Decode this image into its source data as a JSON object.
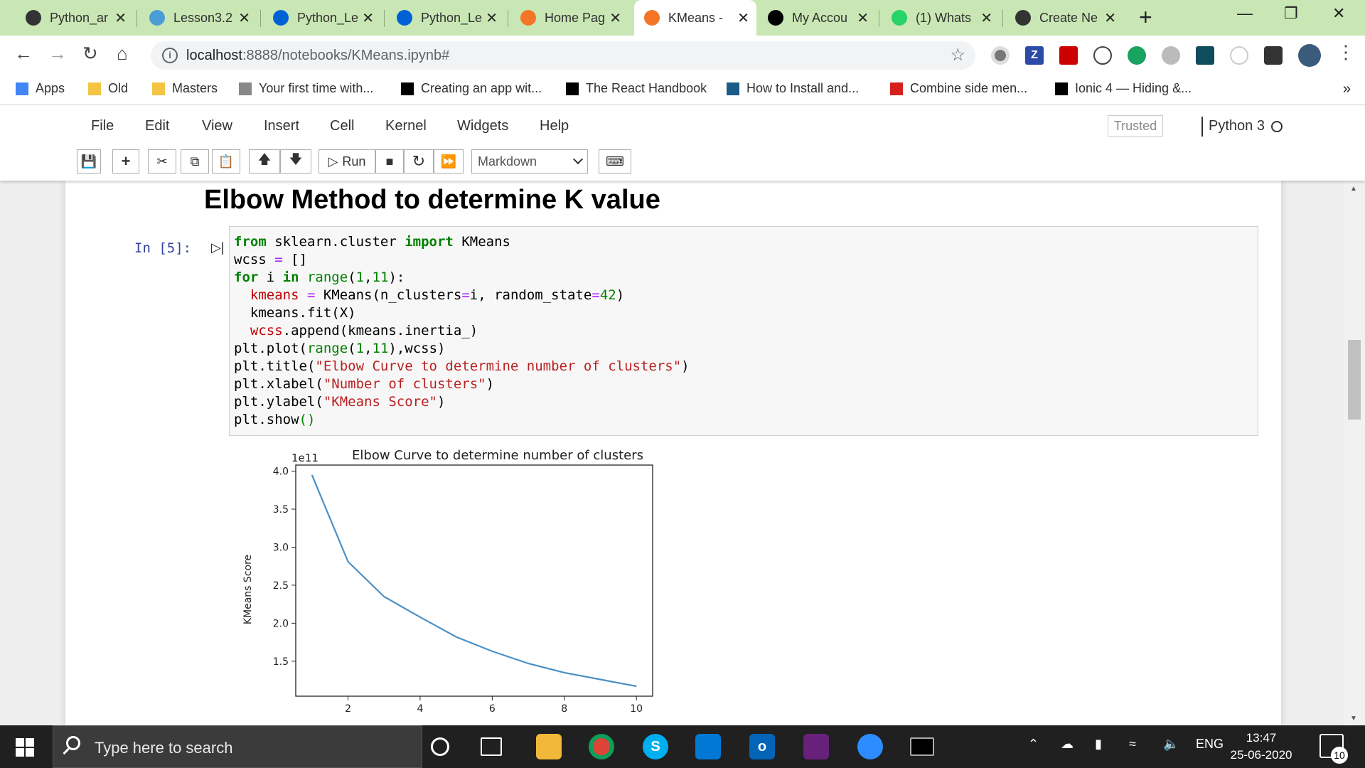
{
  "browser": {
    "tabs": [
      {
        "title": "Python_ar",
        "icon": "github-icon",
        "color": "#333333"
      },
      {
        "title": "Lesson3.2",
        "icon": "unc-icon",
        "color": "#4b9cd3"
      },
      {
        "title": "Python_Le",
        "icon": "box-icon",
        "color": "#0061d5"
      },
      {
        "title": "Python_Le",
        "icon": "box-icon",
        "color": "#0061d5"
      },
      {
        "title": "Home Pag",
        "icon": "spinner-icon",
        "color": "#f37626"
      },
      {
        "title": "KMeans -",
        "icon": "jupyter-icon",
        "color": "#f37626",
        "active": true
      },
      {
        "title": "My Accou",
        "icon": "kc-icon",
        "color": "#000000"
      },
      {
        "title": "(1) Whats",
        "icon": "whatsapp-icon",
        "color": "#25d366"
      },
      {
        "title": "Create Ne",
        "icon": "github-icon",
        "color": "#333333"
      }
    ],
    "url_host": "localhost",
    "url_path": ":8888/notebooks/KMeans.ipynb#",
    "bookmarks": [
      {
        "label": "Apps",
        "icon": "apps-grid-icon"
      },
      {
        "label": "Old",
        "icon": "folder-icon"
      },
      {
        "label": "Masters",
        "icon": "folder-icon"
      },
      {
        "label": "Your first time with...",
        "icon": "person-icon"
      },
      {
        "label": "Creating an app wit...",
        "icon": "dev-icon"
      },
      {
        "label": "The React Handbook",
        "icon": "react-handbook-icon"
      },
      {
        "label": "How to Install and...",
        "icon": "react-icon"
      },
      {
        "label": "Combine side men...",
        "icon": "ionic-icon"
      },
      {
        "label": "Ionic 4 — Hiding &...",
        "icon": "medium-icon"
      }
    ],
    "bookmarks_overflow": "»"
  },
  "jupyter": {
    "menu": [
      "File",
      "Edit",
      "View",
      "Insert",
      "Cell",
      "Kernel",
      "Widgets",
      "Help"
    ],
    "trusted": "Trusted",
    "kernel": "Python 3",
    "run_label": "Run",
    "cell_type": "Markdown",
    "heading": "Elbow Method to determine K value",
    "prompt": "In [5]:"
  },
  "code": {
    "l1_kw1": "from",
    "l1_mod": " sklearn.cluster ",
    "l1_kw2": "import",
    "l1_name": " KMeans",
    "l2": "wcss ",
    "l2_op": "=",
    "l2_rest": " []",
    "l3_kw": "for",
    "l3_i": " i ",
    "l3_in": "in",
    "l3_range": " range",
    "l3_args": "(",
    "l3_n1": "1",
    "l3_c": ",",
    "l3_n2": "11",
    "l3_end": "):",
    "l4_var": "  kmeans ",
    "l4_op": "=",
    "l4_call": " KMeans(n_clusters",
    "l4_op2": "=",
    "l4_mid": "i, random_state",
    "l4_op3": "=",
    "l4_num": "42",
    "l4_end": ")",
    "l5": "  kmeans.fit(X)",
    "l6_var": "  wcss",
    "l6_rest": ".append(kmeans.inertia_)",
    "l7_a": "plt.plot(",
    "l7_range": "range",
    "l7_b": "(",
    "l7_n1": "1",
    "l7_c": ",",
    "l7_n2": "11",
    "l7_d": "),wcss)",
    "l8_a": "plt.title(",
    "l8_s": "\"Elbow Curve to determine number of clusters\"",
    "l8_b": ")",
    "l9_a": "plt.xlabel(",
    "l9_s": "\"Number of clusters\"",
    "l9_b": ")",
    "l10_a": "plt.ylabel(",
    "l10_s": "\"KMeans Score\"",
    "l10_b": ")",
    "l11_a": "plt.show",
    "l11_b": "()"
  },
  "chart_data": {
    "type": "line",
    "title": "Elbow Curve to determine number of clusters",
    "xlabel": "",
    "ylabel": "KMeans Score",
    "offset_text": "1e11",
    "x": [
      1,
      2,
      3,
      4,
      5,
      6,
      7,
      8,
      9,
      10
    ],
    "y": [
      3.95,
      2.81,
      2.35,
      2.08,
      1.82,
      1.63,
      1.47,
      1.35,
      1.26,
      1.17
    ],
    "xlim": [
      0.55,
      10.45
    ],
    "ylim": [
      1.04,
      4.08
    ],
    "xticks": [
      "2",
      "4",
      "6",
      "8",
      "10"
    ],
    "xtick_values": [
      2,
      4,
      6,
      8,
      10
    ],
    "yticks": [
      "1.5",
      "2.0",
      "2.5",
      "3.0",
      "3.5",
      "4.0"
    ],
    "ytick_values": [
      1.5,
      2.0,
      2.5,
      3.0,
      3.5,
      4.0
    ],
    "line_color": "#4a90c4"
  },
  "taskbar": {
    "search_placeholder": "Type here to search",
    "language": "ENG",
    "time": "13:47",
    "date": "25-06-2020",
    "notifications": "10"
  }
}
